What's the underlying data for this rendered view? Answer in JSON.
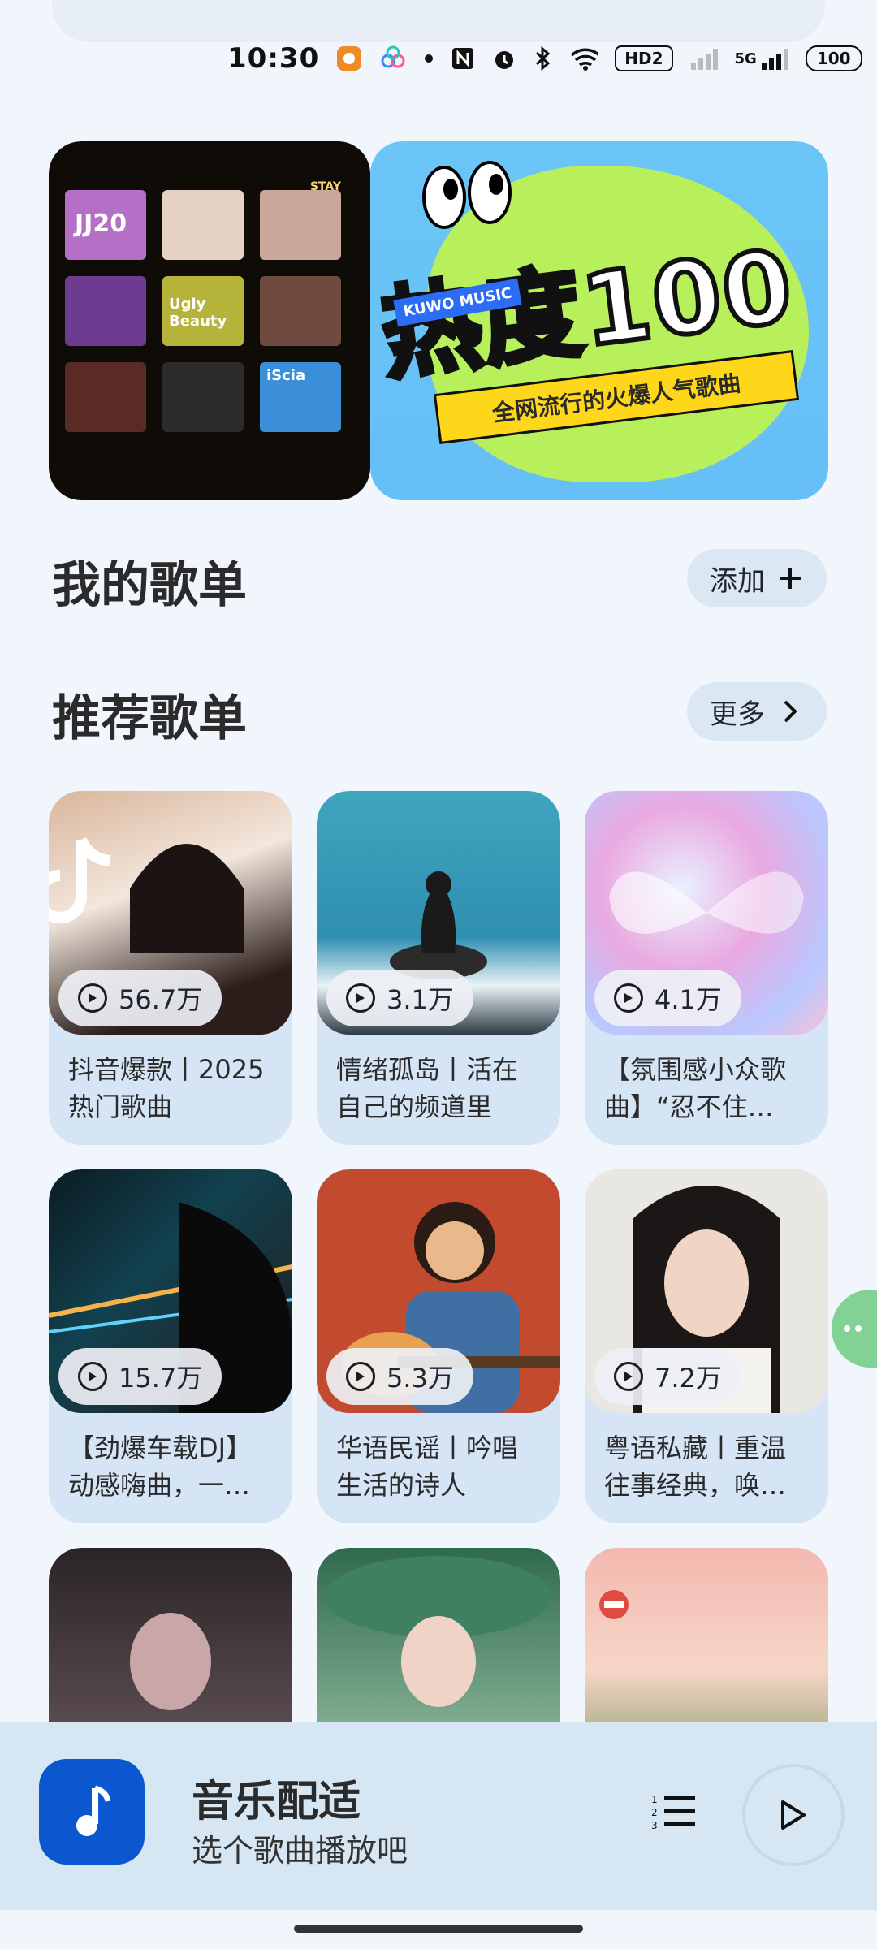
{
  "status_bar": {
    "time": "10:30",
    "battery": "100",
    "network_badge": "HD2",
    "network_type": "5G"
  },
  "banner": {
    "left_caption": "STAY WITH ME",
    "left_album_texts": [
      "JJ20",
      "Ugly Beauty",
      "iScia"
    ],
    "headline": "热度100",
    "tag": "KUWO MUSIC",
    "subtitle": "全网流行的火爆人气歌曲",
    "page_count": 3,
    "active_page": 0
  },
  "my_playlists": {
    "title": "我的歌单",
    "add_label": "添加"
  },
  "recommended": {
    "title": "推荐歌单",
    "more_label": "更多"
  },
  "cards": [
    {
      "plays": "56.7万",
      "title": "抖音爆款丨2025热门歌曲",
      "cover": "girl-portrait-tiktok"
    },
    {
      "plays": "3.1万",
      "title": "情绪孤岛丨活在自己的频道里",
      "cover": "cat-on-rock-sea"
    },
    {
      "plays": "4.1万",
      "title": "【氛围感小众歌曲】“忍不住…",
      "cover": "pastel-butterfly"
    },
    {
      "plays": "15.7万",
      "title": "【劲爆车载DJ】动感嗨曲，一…",
      "cover": "night-car-city"
    },
    {
      "plays": "5.3万",
      "title": "华语民谣丨吟唱生活的诗人",
      "cover": "guitar-singer-illustration"
    },
    {
      "plays": "7.2万",
      "title": "粤语私藏丨重温往事经典，唤…",
      "cover": "retro-woman-portrait"
    }
  ],
  "cards_partial": [
    {
      "cover": "girl-dark-portrait"
    },
    {
      "cover": "girl-green-hat"
    },
    {
      "cover": "sunset-car"
    }
  ],
  "player": {
    "title": "音乐配适",
    "subtitle": "选个歌曲播放吧"
  },
  "colors": {
    "background": "#f1f6fc",
    "card": "#d5e5f6",
    "pill": "#dbe7f3",
    "player_bar": "#d7e6f3",
    "accent_blue": "#0b57d0",
    "float_green": "#82d296"
  }
}
